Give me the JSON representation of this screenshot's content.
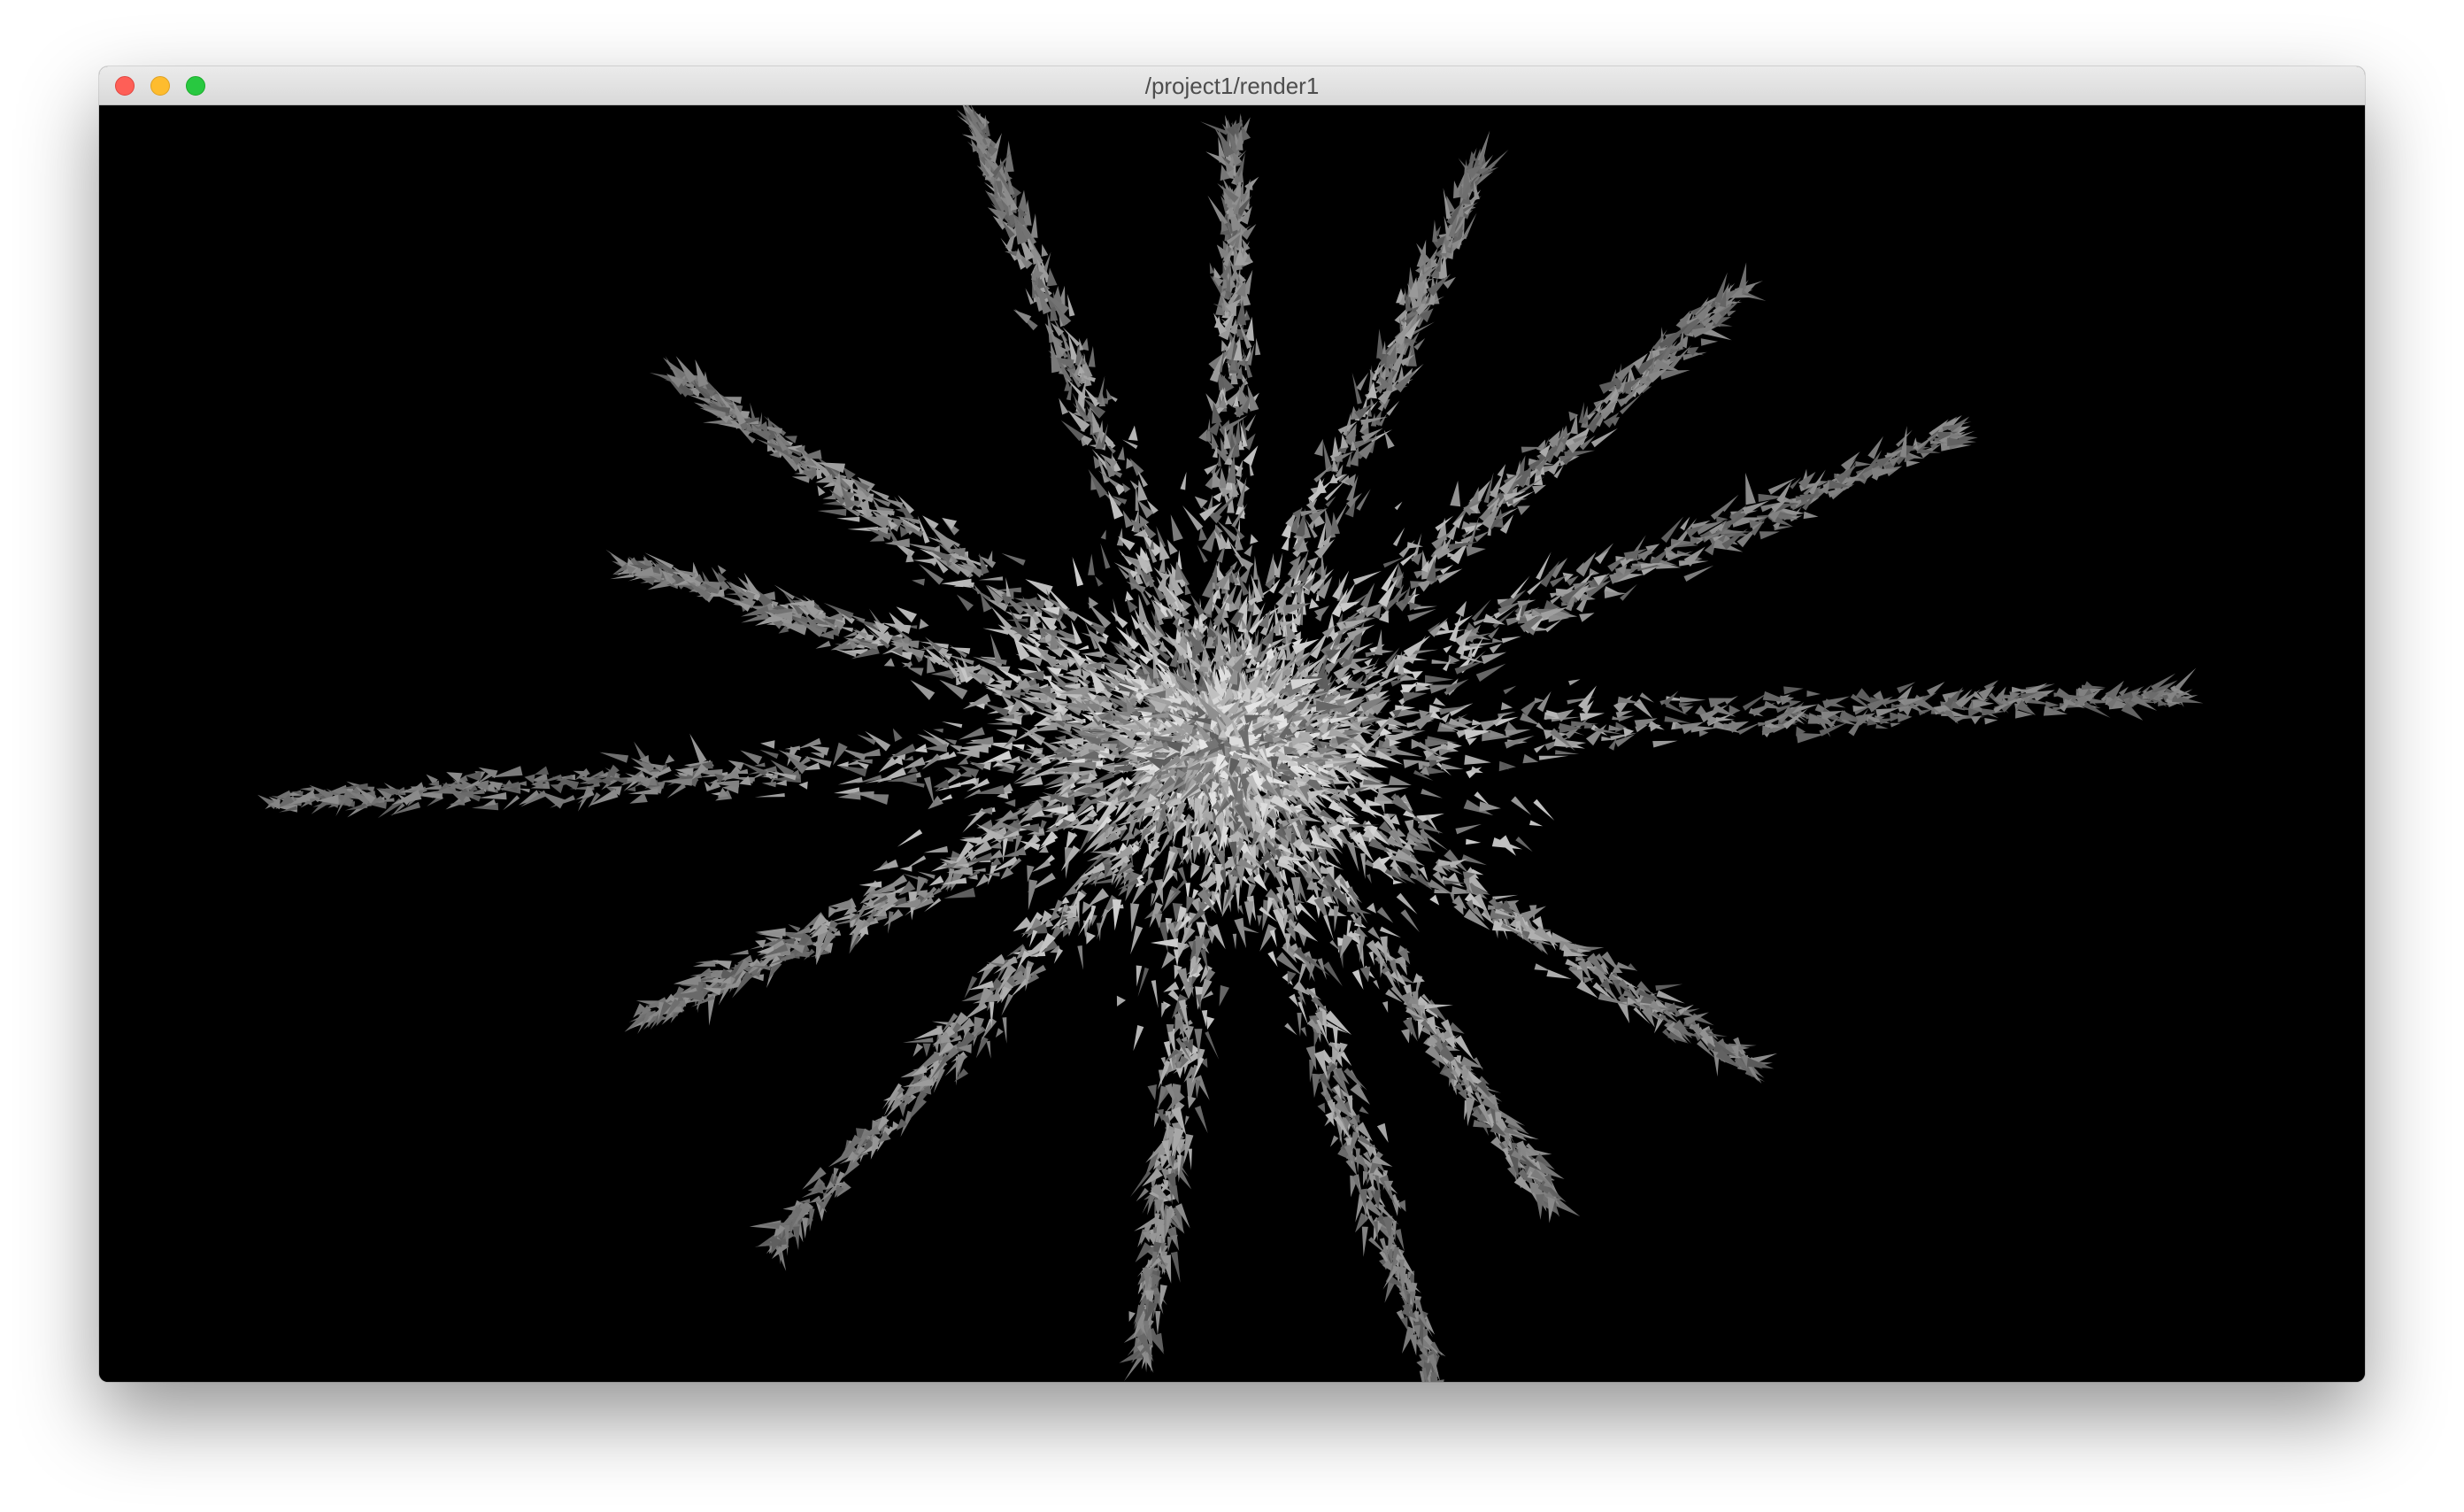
{
  "window": {
    "title": "/project1/render1",
    "controls": {
      "close": "close-icon",
      "minimize": "minimize-icon",
      "zoom": "zoom-icon"
    }
  },
  "render": {
    "background_color": "#000000",
    "particle_color": "#c8c8c8",
    "content": "particle-burst"
  }
}
